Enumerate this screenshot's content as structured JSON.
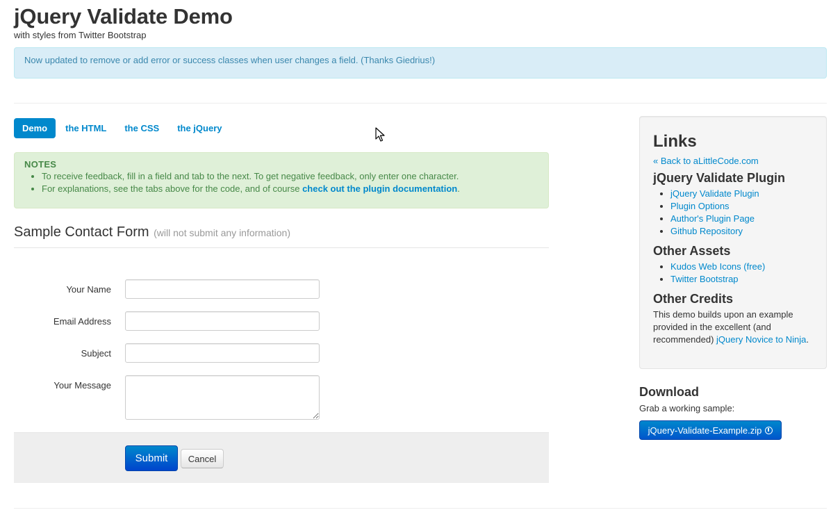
{
  "header": {
    "title": "jQuery Validate Demo",
    "subtitle": "with styles from Twitter Bootstrap"
  },
  "alert": {
    "text": "Now updated to remove or add error or success classes when user changes a field. (Thanks Giedrius!)"
  },
  "tabs": [
    {
      "label": "Demo",
      "active": true
    },
    {
      "label": "the HTML",
      "active": false
    },
    {
      "label": "the CSS",
      "active": false
    },
    {
      "label": "the jQuery",
      "active": false
    }
  ],
  "notes": {
    "title": "NOTES",
    "item1": "To receive feedback, fill in a field and tab to the next. To get negative feedback, only enter one character.",
    "item2_prefix": "For explanations, see the tabs above for the code, and of course ",
    "item2_link": "check out the plugin documentation",
    "item2_suffix": "."
  },
  "form": {
    "legend": "Sample Contact Form",
    "legend_sub": "(will not submit any information)",
    "fields": {
      "name_label": "Your Name",
      "email_label": "Email Address",
      "subject_label": "Subject",
      "message_label": "Your Message",
      "name_value": "",
      "email_value": "",
      "subject_value": "",
      "message_value": ""
    },
    "submit_label": "Submit",
    "cancel_label": "Cancel"
  },
  "sidebar": {
    "links_title": "Links",
    "back_link": "« Back to aLittleCode.com",
    "plugin_title": "jQuery Validate Plugin",
    "plugin_links": [
      "jQuery Validate Plugin",
      "Plugin Options",
      "Author's Plugin Page",
      "Github Repository"
    ],
    "assets_title": "Other Assets",
    "assets_links": [
      "Kudos Web Icons (free)",
      "Twitter Bootstrap"
    ],
    "credits_title": "Other Credits",
    "credits_text": "This demo builds upon an example provided in the excellent (and recommended) ",
    "credits_link": "jQuery Novice to Ninja",
    "credits_suffix": "."
  },
  "download": {
    "title": "Download",
    "subtitle": "Grab a working sample:",
    "button_label": "jQuery-Validate-Example.zip",
    "button_icon": "download-circle-icon"
  },
  "colors": {
    "link": "#0088cc",
    "info_bg": "#d9edf7",
    "info_text": "#3a87ad",
    "success_bg": "#dff0d8",
    "success_text": "#468847",
    "well_bg": "#f5f5f5"
  }
}
